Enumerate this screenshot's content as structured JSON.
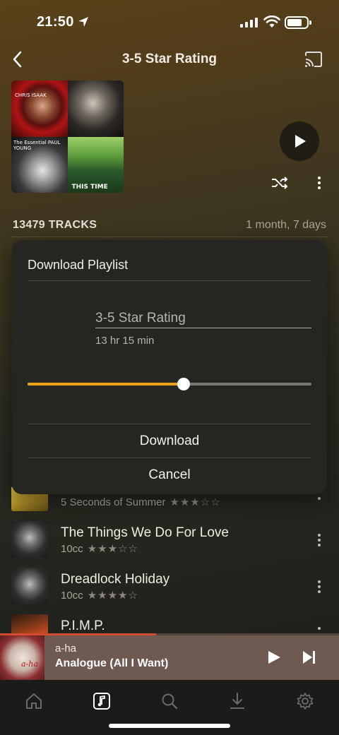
{
  "status": {
    "time": "21:50"
  },
  "header": {
    "title": "3-5 Star Rating"
  },
  "playlist": {
    "tracks_count_label": "13479 TRACKS",
    "duration_label": "1 month, 7 days",
    "art_texts": [
      "CHRIS ISAAK",
      "The Essential PAUL YOUNG",
      "THIS TIME"
    ]
  },
  "tracks": [
    {
      "title": "",
      "artist": "5 Seconds of Summer",
      "rating": 3,
      "stars": "★★★☆☆"
    },
    {
      "title": "The Things We Do For Love",
      "artist": "10cc",
      "rating": 3,
      "stars": "★★★☆☆"
    },
    {
      "title": "Dreadlock Holiday",
      "artist": "10cc",
      "rating": 4,
      "stars": "★★★★☆"
    },
    {
      "title": "P.I.M.P.",
      "artist": "",
      "rating": null,
      "stars": ""
    }
  ],
  "dialog": {
    "title": "Download Playlist",
    "playlist_name": "3-5 Star Rating",
    "duration": "13 hr 15 min",
    "slider_fraction": 0.55,
    "download_label": "Download",
    "cancel_label": "Cancel"
  },
  "now_playing": {
    "artist": "a-ha",
    "title": "Analogue (All I Want)",
    "progress_fraction": 0.46,
    "art_text": "a-ha"
  },
  "tabs": [
    {
      "icon": "home-icon",
      "active": false
    },
    {
      "icon": "music-note-icon",
      "active": true
    },
    {
      "icon": "search-icon",
      "active": false
    },
    {
      "icon": "download-icon",
      "active": false
    },
    {
      "icon": "settings-icon",
      "active": false
    }
  ],
  "colors": {
    "accent": "#e9a417",
    "progress": "#d24a30",
    "now_playing_bg": "#6e5a50"
  }
}
